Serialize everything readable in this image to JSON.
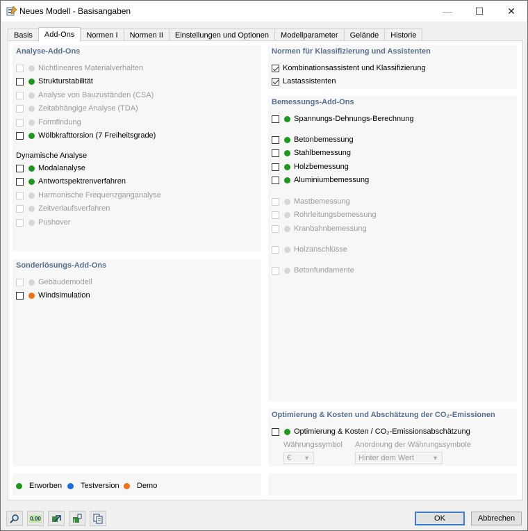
{
  "window": {
    "title": "Neues Modell - Basisangaben",
    "min": "—",
    "max": "☐",
    "close": "✕"
  },
  "tabs": [
    {
      "label": "Basis"
    },
    {
      "label": "Add-Ons"
    },
    {
      "label": "Normen I"
    },
    {
      "label": "Normen II"
    },
    {
      "label": "Einstellungen und Optionen"
    },
    {
      "label": "Modellparameter"
    },
    {
      "label": "Gelände"
    },
    {
      "label": "Historie"
    }
  ],
  "analysis": {
    "title": "Analyse-Add-Ons",
    "items": [
      {
        "label": "Nichtlineares Materialverhalten"
      },
      {
        "label": "Strukturstabilität"
      },
      {
        "label": "Analyse von Bauzuständen (CSA)"
      },
      {
        "label": "Zeitabhängige Analyse (TDA)"
      },
      {
        "label": "Formfindung"
      },
      {
        "label": "Wölbkrafttorsion (7 Freiheitsgrade)"
      }
    ],
    "dynamic_title": "Dynamische Analyse",
    "dynamic_items": [
      {
        "label": "Modalanalyse"
      },
      {
        "label": "Antwortspektrenverfahren"
      },
      {
        "label": "Harmonische Frequenzganganalyse"
      },
      {
        "label": "Zeitverlaufsverfahren"
      },
      {
        "label": "Pushover"
      }
    ]
  },
  "special": {
    "title": "Sonderlösungs-Add-Ons",
    "items": [
      {
        "label": "Gebäudemodell"
      },
      {
        "label": "Windsimulation"
      }
    ]
  },
  "norms": {
    "title": "Normen für Klassifizierung und Assistenten",
    "items": [
      {
        "label": "Kombinationsassistent und Klassifizierung"
      },
      {
        "label": "Lastassistenten"
      }
    ]
  },
  "design": {
    "title": "Bemessungs-Add-Ons",
    "items": [
      {
        "label": "Spannungs-Dehnungs-Berechnung"
      },
      {
        "label": "Betonbemessung"
      },
      {
        "label": "Stahlbemessung"
      },
      {
        "label": "Holzbemessung"
      },
      {
        "label": "Aluminiumbemessung"
      },
      {
        "label": "Mastbemessung"
      },
      {
        "label": "Rohrleitungsbemessung"
      },
      {
        "label": "Kranbahnbemessung"
      },
      {
        "label": "Holzanschlüsse"
      },
      {
        "label": "Betonfundamente"
      }
    ]
  },
  "optimization": {
    "title": "Optimierung & Kosten und Abschätzung der CO₂-Emissionen",
    "item": "Optimierung & Kosten / CO₂-Emissionsabschätzung",
    "currency_label": "Währungssymbol",
    "currency_value": "€",
    "position_label": "Anordnung der Währungssymbole",
    "position_value": "Hinter dem Wert"
  },
  "legend": [
    {
      "label": "Erworben"
    },
    {
      "label": "Testversion"
    },
    {
      "label": "Demo"
    }
  ],
  "buttons": {
    "ok": "OK",
    "cancel": "Abbrechen",
    "units_icon_text": "0.00"
  },
  "colors": {
    "acquired": "#1a9a1a",
    "trial": "#1a6fe6",
    "demo": "#f07016",
    "disabled_dot": "#d6d6d6",
    "section_title": "#5a6f8f",
    "default_border": "#3c7fd1"
  }
}
